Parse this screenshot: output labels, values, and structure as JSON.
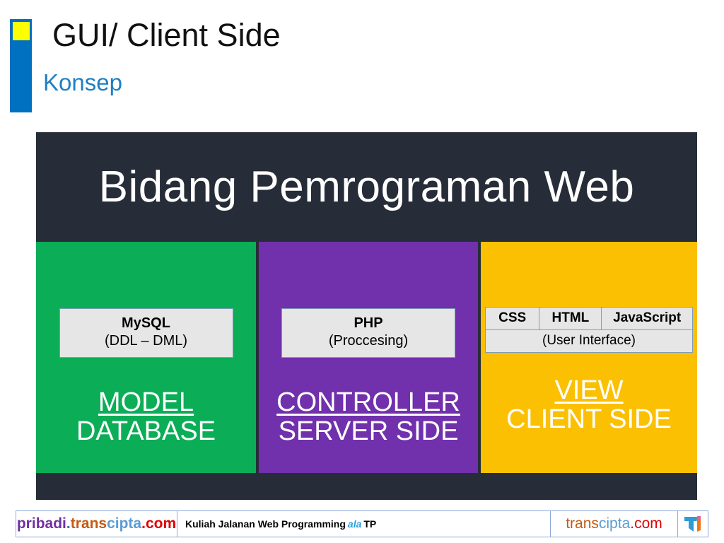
{
  "header": {
    "title": "GUI/ Client Side",
    "subtitle": "Konsep",
    "accent_blue": "#0070c0",
    "accent_yellow": "#ffff00",
    "subtitle_color": "#1f7fc4"
  },
  "diagram": {
    "banner_title": "Bidang Pemrograman Web",
    "banner_bg": "#262d38",
    "columns": [
      {
        "id": "model",
        "bg": "#0cad57",
        "tech_name": "MySQL",
        "tech_sub": "(DDL – DML)",
        "role_name": "MODEL",
        "role_sub": "DATABASE"
      },
      {
        "id": "controller",
        "bg": "#7130ac",
        "tech_name": "PHP",
        "tech_sub": "(Proccesing)",
        "role_name": "CONTROLLER",
        "role_sub": "SERVER SIDE"
      },
      {
        "id": "view",
        "bg": "#fcc003",
        "tech_cells": [
          "CSS",
          "HTML",
          "JavaScript"
        ],
        "tech_sub": "(User Interface)",
        "role_name": "VIEW",
        "role_sub": "CLIENT SIDE"
      }
    ]
  },
  "footer": {
    "brand_left": {
      "part1": "pribadi",
      "dot1": ".",
      "part2": "trans",
      "part3": "cipta",
      "dot2": ".",
      "part4": "com"
    },
    "caption_pre": "Kuliah Jalanan Web Programming",
    "caption_em": "ala",
    "caption_post": "TP",
    "brand_right": {
      "part1": "trans",
      "part2": "cipta",
      "dot": ".",
      "part3": "com"
    },
    "logo_name": "transcipta-t-logo"
  }
}
